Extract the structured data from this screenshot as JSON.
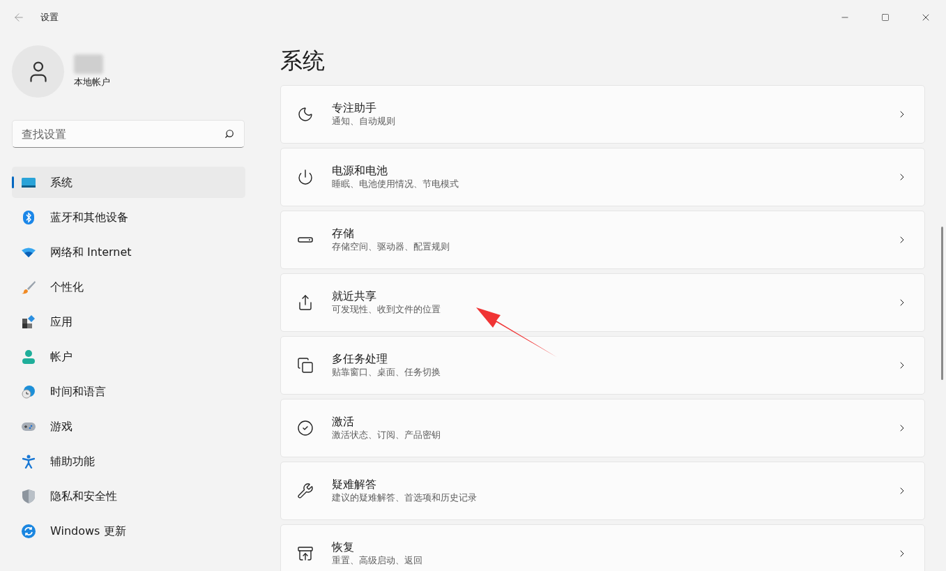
{
  "window": {
    "title": "设置"
  },
  "account": {
    "type": "本地帐户"
  },
  "search": {
    "placeholder": "查找设置"
  },
  "sidebar": {
    "items": [
      {
        "label": "系统",
        "selected": true
      },
      {
        "label": "蓝牙和其他设备",
        "selected": false
      },
      {
        "label": "网络和 Internet",
        "selected": false
      },
      {
        "label": "个性化",
        "selected": false
      },
      {
        "label": "应用",
        "selected": false
      },
      {
        "label": "帐户",
        "selected": false
      },
      {
        "label": "时间和语言",
        "selected": false
      },
      {
        "label": "游戏",
        "selected": false
      },
      {
        "label": "辅助功能",
        "selected": false
      },
      {
        "label": "隐私和安全性",
        "selected": false
      },
      {
        "label": "Windows 更新",
        "selected": false
      }
    ]
  },
  "page": {
    "title": "系统"
  },
  "cards": [
    {
      "title": "专注助手",
      "subtitle": "通知、自动规则"
    },
    {
      "title": "电源和电池",
      "subtitle": "睡眠、电池使用情况、节电模式"
    },
    {
      "title": "存储",
      "subtitle": "存储空间、驱动器、配置规则"
    },
    {
      "title": "就近共享",
      "subtitle": "可发现性、收到文件的位置"
    },
    {
      "title": "多任务处理",
      "subtitle": "贴靠窗口、桌面、任务切换"
    },
    {
      "title": "激活",
      "subtitle": "激活状态、订阅、产品密钥"
    },
    {
      "title": "疑难解答",
      "subtitle": "建议的疑难解答、首选项和历史记录"
    },
    {
      "title": "恢复",
      "subtitle": "重置、高级启动、返回"
    }
  ]
}
